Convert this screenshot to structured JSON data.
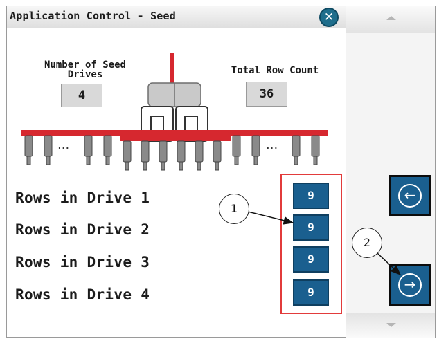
{
  "dialog": {
    "title": "Application Control - Seed",
    "close_glyph": "✕"
  },
  "seed_drives": {
    "label": "Number of Seed Drives",
    "value": "4"
  },
  "row_count": {
    "label": "Total Row Count",
    "value": "36"
  },
  "planter": {
    "ellipsis_left": "···",
    "ellipsis_right": "···"
  },
  "rows": [
    {
      "label": "Rows in Drive 1",
      "value": "9"
    },
    {
      "label": "Rows in Drive 2",
      "value": "9"
    },
    {
      "label": "Rows in Drive 3",
      "value": "9"
    },
    {
      "label": "Rows in Drive 4",
      "value": "9"
    }
  ],
  "callouts": [
    "1",
    "2"
  ],
  "nav": {
    "back_glyph": "←",
    "next_glyph": "→"
  },
  "colors": {
    "accent_blue": "#1a5f8f",
    "planter_red": "#d6282f",
    "highlight_red": "#e23b3b"
  }
}
